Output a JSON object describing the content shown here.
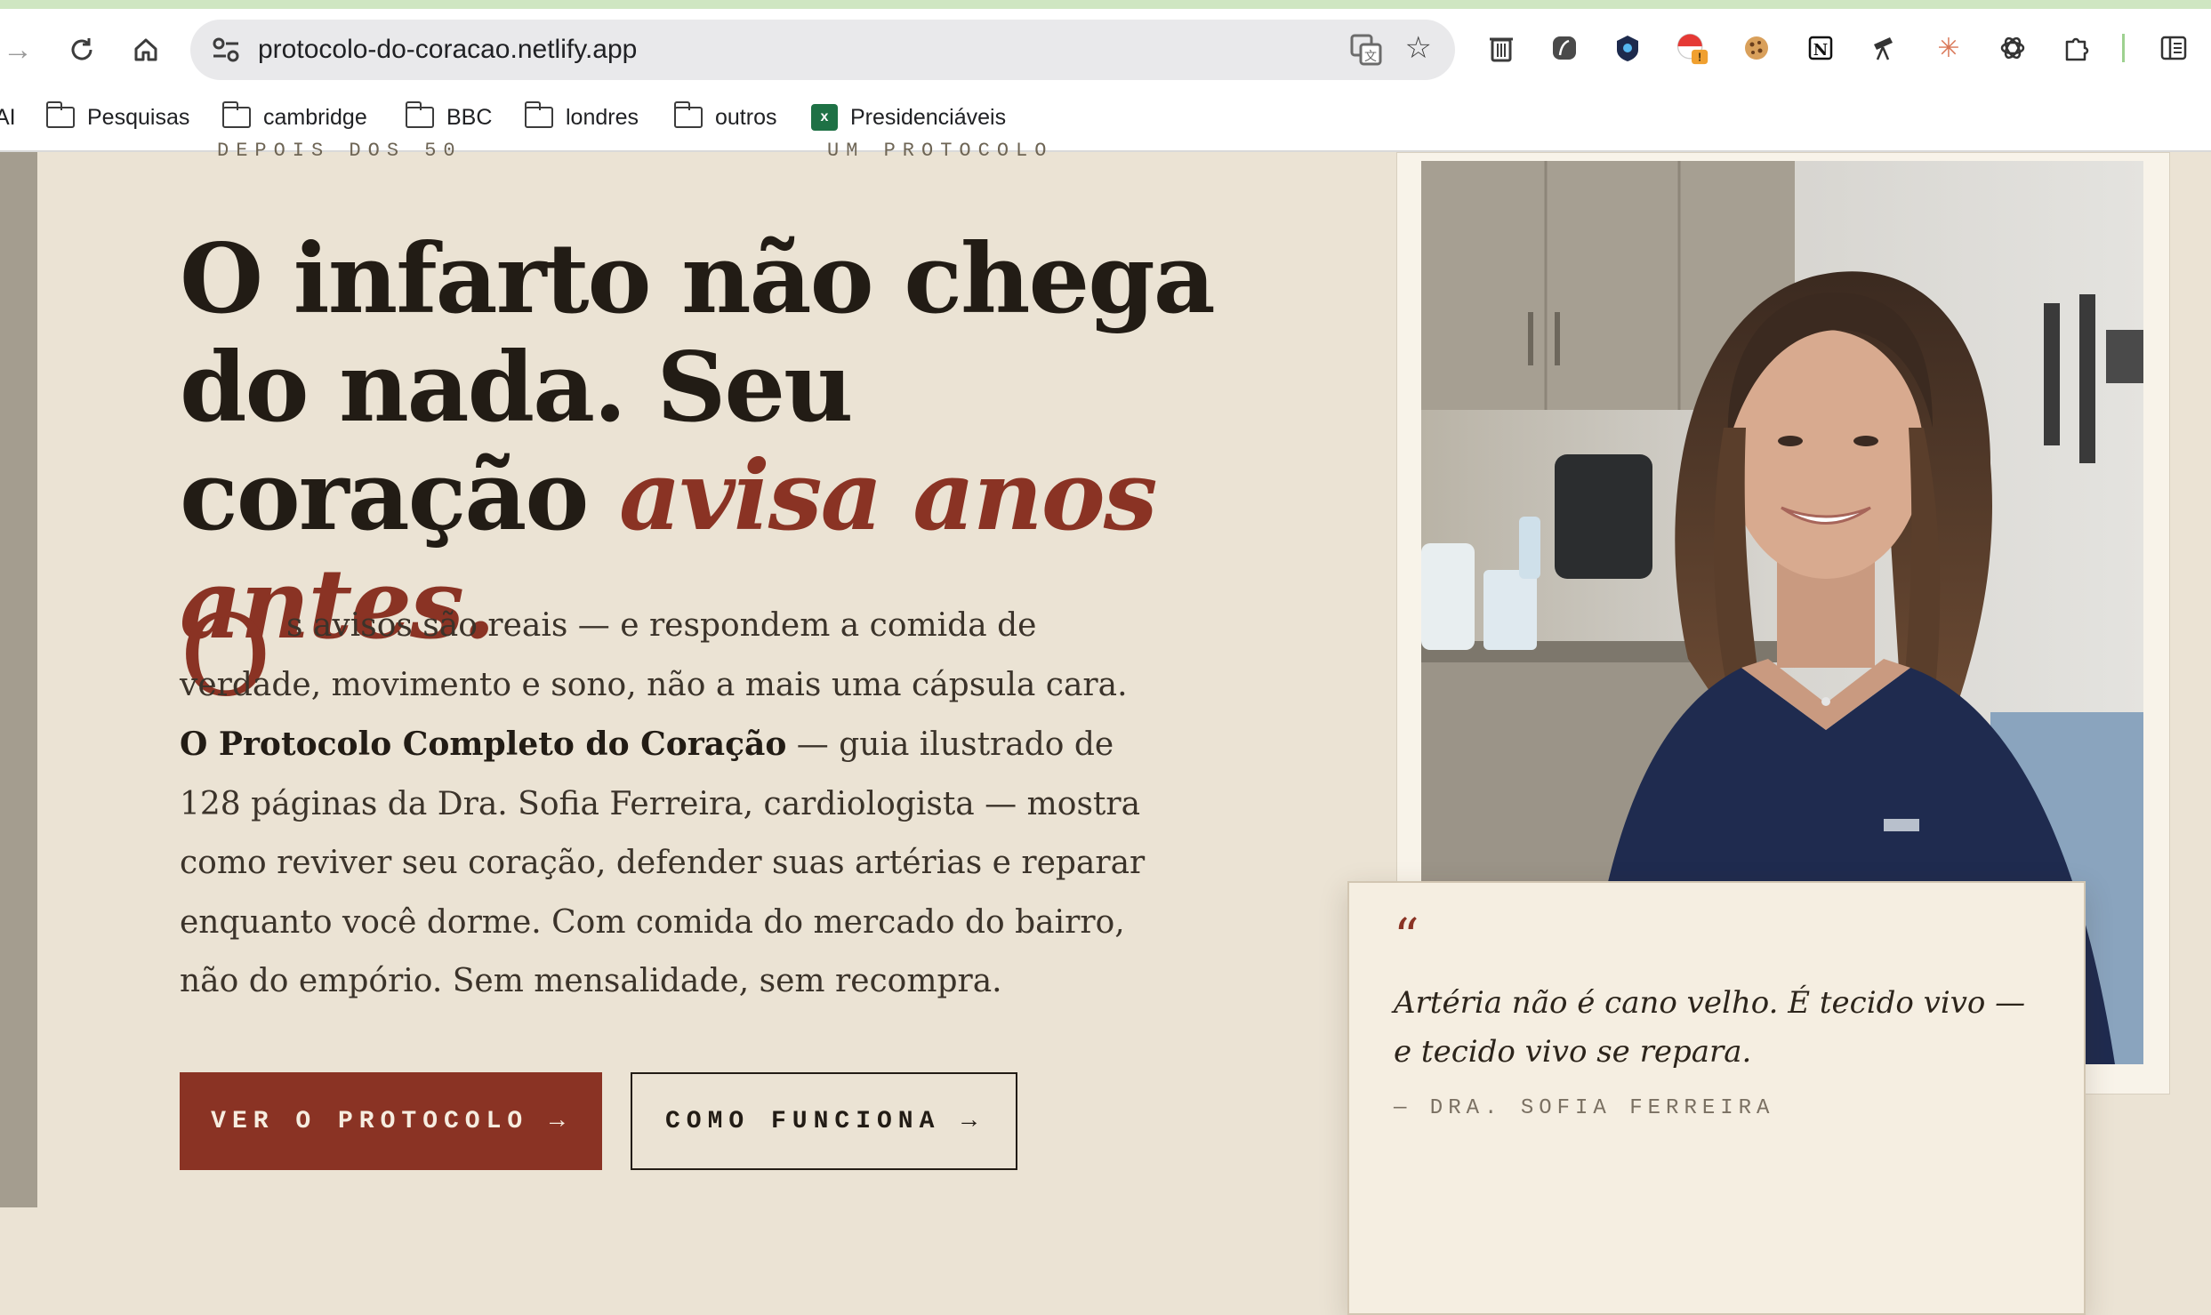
{
  "browser": {
    "url": "protocolo-do-coracao.netlify.app",
    "bookmarks": [
      {
        "label": "AI",
        "type": "partial"
      },
      {
        "label": "Pesquisas",
        "type": "folder"
      },
      {
        "label": "cambridge",
        "type": "folder"
      },
      {
        "label": "BBC",
        "type": "folder"
      },
      {
        "label": "londres",
        "type": "folder"
      },
      {
        "label": "outros",
        "type": "folder"
      },
      {
        "label": "Presidenciáveis",
        "type": "sheet"
      }
    ],
    "extensions": [
      "trash-icon",
      "feather-icon",
      "shield-icon",
      "pokeball-alert-icon",
      "cookie-icon",
      "notion-icon",
      "telescope-icon",
      "claude-icon",
      "openai-icon",
      "puzzle-icon",
      "sidebar-icon"
    ]
  },
  "hero": {
    "kicker_left": "DEPOIS DOS 50",
    "kicker_right": "UM PROTOCOLO",
    "headline_plain": "O infarto não chega do nada. Seu coração ",
    "headline_accent": "avisa anos antes.",
    "dropcap": "O",
    "body_start": "s avisos são reais — e respondem a comida de verdade, movimento e sono, não a mais uma cápsula cara. ",
    "body_bold": "O Protocolo Completo do Coração",
    "body_end": " — guia ilustrado de 128 páginas da Dra. Sofia Ferreira, cardiologista — mostra como reviver seu coração, defender suas artérias e reparar enquanto você dorme. Com comida do mercado do bairro, não do empório. Sem mensalidade, sem recompra.",
    "cta_primary": "VER O PROTOCOLO →",
    "cta_secondary": "COMO FUNCIONA →"
  },
  "quote": {
    "mark": "“",
    "text": "Artéria não é cano velho. É tecido vivo — e tecido vivo se repara.",
    "author": "— DRA. SOFIA FERREIRA"
  },
  "colors": {
    "accent": "#8a3324",
    "background": "#ebe3d4",
    "ink": "#221c15"
  }
}
